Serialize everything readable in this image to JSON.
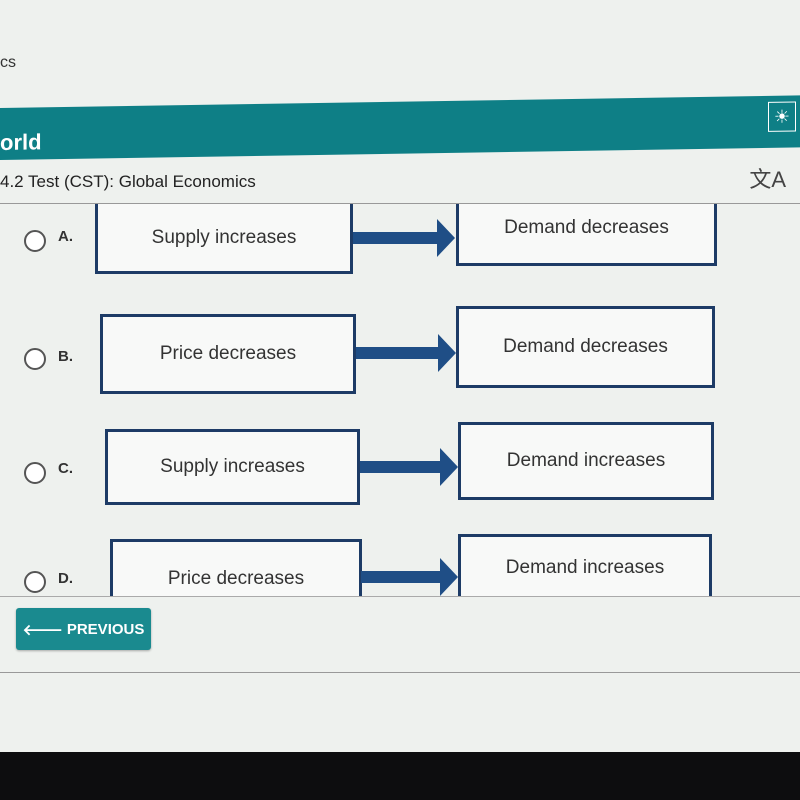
{
  "breadcrumb": "cs",
  "app": {
    "name": "orld",
    "logo_icon": "lightbulb-icon",
    "color": "#0e7f86"
  },
  "title": "4.2 Test (CST): Global Economics",
  "translate_icon": "translate-icon",
  "options": [
    {
      "letter": "A.",
      "cause": "Supply increases",
      "effect": "Demand decreases"
    },
    {
      "letter": "B.",
      "cause": "Price decreases",
      "effect": "Demand decreases"
    },
    {
      "letter": "C.",
      "cause": "Supply increases",
      "effect": "Demand increases"
    },
    {
      "letter": "D.",
      "cause": "Price decreases",
      "effect": "Demand increases"
    }
  ],
  "previous_label": "PREVIOUS"
}
